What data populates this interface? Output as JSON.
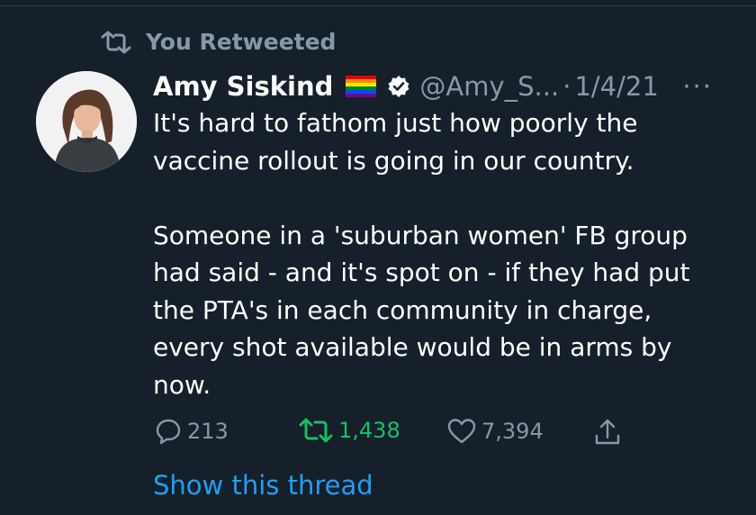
{
  "context": {
    "label": "You Retweeted",
    "icon": "retweet-icon"
  },
  "author": {
    "display_name": "Amy Siskind",
    "flag_icon": "rainbow-flag-icon",
    "verified_icon": "verified-badge-icon",
    "handle": "@Amy_S...",
    "separator": "·",
    "date": "1/4/21"
  },
  "more_label": "···",
  "tweet": {
    "paragraph_1": "It's hard to fathom just how poorly the vaccine rollout is going in our country.",
    "paragraph_2": "Someone in a 'suburban women' FB group had said - and it's spot on - if they had put the PTA's in each community in charge, every shot available would be in arms by now."
  },
  "actions": {
    "replies": "213",
    "retweets": "1,438",
    "likes": "7,394"
  },
  "show_thread": "Show this thread",
  "colors": {
    "background": "#15202b",
    "muted": "#8899a6",
    "retweet_active": "#17bf63",
    "link": "#1da1f2"
  }
}
